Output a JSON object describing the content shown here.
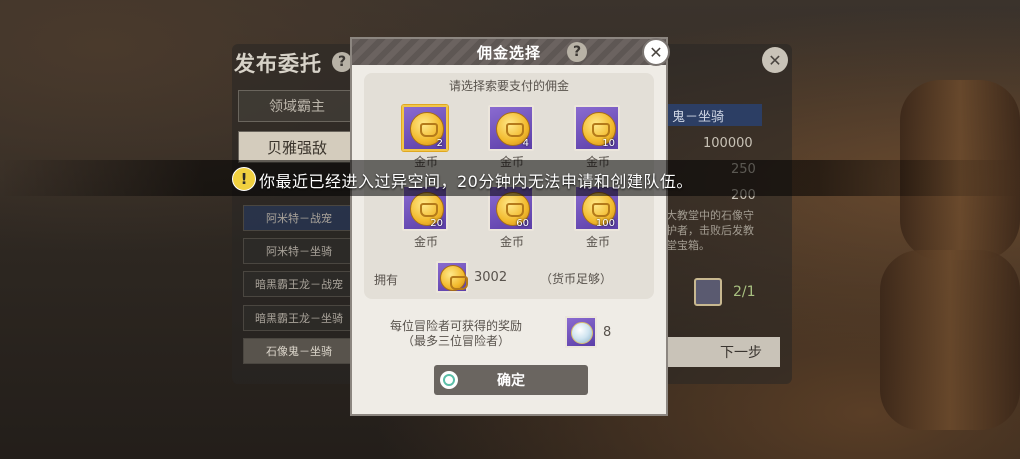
{
  "background_panel": {
    "title": "发布委托",
    "categories": [
      "领域霸主",
      "贝雅强敌"
    ],
    "selected_category": "贝雅强敌",
    "list_items": [
      "阿米特－战宠",
      "阿米特－坐骑",
      "暗黑霸王龙－战宠",
      "暗黑霸王龙－坐骑",
      "石像鬼－坐骑"
    ],
    "right": {
      "title": "鬼－坐骑",
      "values": [
        "100000",
        "250",
        "200"
      ],
      "description": "大教堂中的石像守护者，击败后发教堂宝箱。",
      "count": "2/1",
      "next_label": "下一步"
    }
  },
  "modal": {
    "title": "佣金选择",
    "prompt": "请选择索要支付的佣金",
    "coins": [
      {
        "amount": "2",
        "label": "金币",
        "selected": true
      },
      {
        "amount": "4",
        "label": "金币",
        "selected": false
      },
      {
        "amount": "10",
        "label": "金币",
        "selected": false
      },
      {
        "amount": "20",
        "label": "金币",
        "selected": false
      },
      {
        "amount": "60",
        "label": "金币",
        "selected": false
      },
      {
        "amount": "100",
        "label": "金币",
        "selected": false
      }
    ],
    "own_label": "拥有",
    "own_value": "3002",
    "own_status": "（货币足够）",
    "reward_line1": "每位冒险者可获得的奖励",
    "reward_line2": "（最多三位冒险者）",
    "reward_value": "8",
    "confirm_label": "确定"
  },
  "notice": {
    "text": "你最近已经进入过异空间，20分钟内无法申请和创建队伍。"
  }
}
